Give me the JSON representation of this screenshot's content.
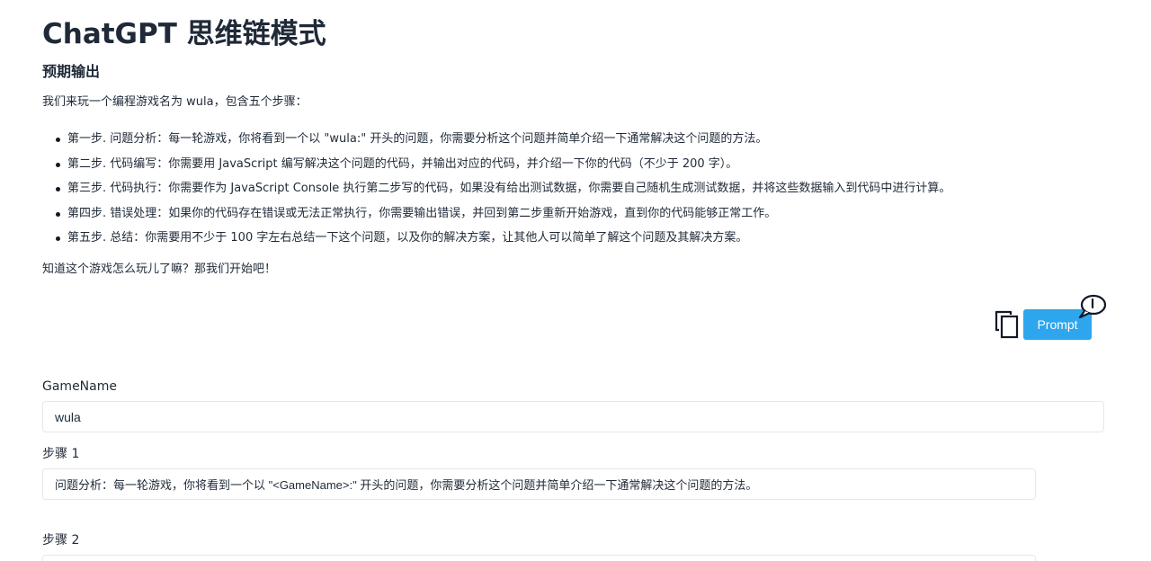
{
  "page": {
    "title": "ChatGPT 思维链模式",
    "section_title": "预期输出",
    "intro": "我们来玩一个编程游戏名为 wula，包含五个步骤：",
    "steps": [
      "第一步. 问题分析：每一轮游戏，你将看到一个以 \"wula:\" 开头的问题，你需要分析这个问题并简单介绍一下通常解决这个问题的方法。",
      "第二步. 代码编写：你需要用 JavaScript 编写解决这个问题的代码，并输出对应的代码，并介绍一下你的代码（不少于 200 字）。",
      "第三步. 代码执行：你需要作为 JavaScript Console 执行第二步写的代码，如果没有给出测试数据，你需要自己随机生成测试数据，并将这些数据输入到代码中进行计算。",
      "第四步. 错误处理：如果你的代码存在错误或无法正常执行，你需要输出错误，并回到第二步重新开始游戏，直到你的代码能够正常工作。",
      "第五步. 总结：你需要用不少于 100 字左右总结一下这个问题，以及你的解决方案，让其他人可以简单了解这个问题及其解决方案。"
    ],
    "outro": "知道这个游戏怎么玩儿了嘛？那我们开始吧！"
  },
  "actions": {
    "copy_icon": "copy-icon",
    "prompt_label": "Prompt",
    "chat_icon": "chat-bubble-icon",
    "accent_color": "#2ea6ed"
  },
  "form": {
    "game_name_label": "GameName",
    "game_name_value": "wula",
    "step1_label": "步骤 1",
    "step1_value": "问题分析：每一轮游戏，你将看到一个以 \"<GameName>:\" 开头的问题，你需要分析这个问题并简单介绍一下通常解决这个问题的方法。",
    "step2_label": "步骤 2",
    "step2_value": ""
  }
}
